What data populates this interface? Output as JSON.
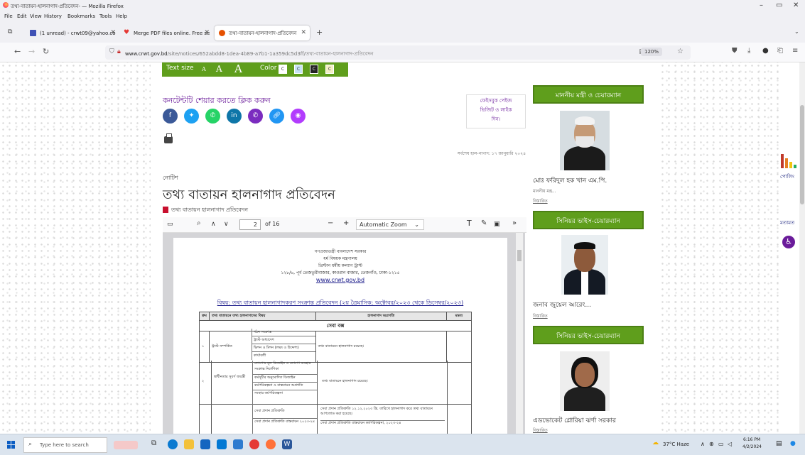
{
  "browser": {
    "window_title": "তথ্য-বাতায়ন-হালনাগাদ-প্রতিবেদন- — Mozilla Firefox",
    "menu": [
      "File",
      "Edit",
      "View",
      "History",
      "Bookmarks",
      "Tools",
      "Help"
    ],
    "tabs": [
      {
        "label": "(1 unread) - crwt09@yahoo.co",
        "icon": "mail-icon"
      },
      {
        "label": "Merge PDF files online. Free se",
        "icon": "ilovepdf-icon"
      },
      {
        "label": "তথ্য-বাতায়ন-হালনাগাদ-প্রতিবেদন",
        "icon": "site-icon"
      }
    ],
    "url_domain": "www.crwt.gov.bd",
    "url_path": "/site/notices/652abdd8-1dea-4b89-a7b1-1a359dc5d3ff/তথ্য-বাতায়ন-হালনাগাদ-প্রতিবেদন",
    "zoom": "120%"
  },
  "page": {
    "text_size_label": "Text size",
    "text_size_options": [
      "A",
      "A",
      "A"
    ],
    "color_label": "Color",
    "color_options": [
      "C",
      "C",
      "C",
      "C"
    ],
    "share_label": "কনটেন্টটি শেয়ার করতে ক্লিক করুন",
    "fb_box": [
      "ফেইসবুক পেইজ",
      "ভিজিট ও লাইক",
      "দিন।"
    ],
    "updated": "সর্বশেষ হাল-নাগাদ: ১৭ জানুয়ারি ২০২৪",
    "notice_label": "নোটিশ",
    "title": "তথ্য বাতায়ন হালনাগাদ প্রতিবেদন",
    "pdf_link": "তথ্য বাতায়ন হালনাগাদ প্রতিবেদন"
  },
  "pdf": {
    "page_current": "2",
    "page_total": "of 16",
    "zoom_option": "Automatic Zoom",
    "header_lines": [
      "গণপ্রজাতন্ত্রী বাংলাদেশ সরকার",
      "ধর্ম বিষয়ক মন্ত্রণালয়",
      "খ্রিস্টান ধর্মীয় কল্যাণ ট্রাস্ট",
      "১২৮/৬, পূর্ব তেজতুরীবাজার, কাওরান বাজার, তেজগাঁও, ঢাকা-১২১৫"
    ],
    "header_url": "www.crwt.gov.bd",
    "subject": "বিষয়: তথ্য বাতায়ন হালনাগাদকরণ সংক্রান্ত প্রতিবেদন (২য় ত্রৈমাসিক: অক্টোবর/২০২৩ থেকে ডিসেম্বর/২০২৩)",
    "table_headers": [
      "ক্রম",
      "তথ্য বাতায়নে তথ্য হালনাগাদের বিষয়",
      "হালনাগাদ অগ্রগতি",
      "মন্তব্য"
    ],
    "section_title": "সেবা বক্স",
    "groups": [
      {
        "num": "১",
        "topic": "ট্রাস্ট সম্পর্কিত",
        "items": [
          "গঠন সংক্রান্ত",
          "ট্রাস্ট অধ্যাদেশ",
          "ভিশন ও মিশন (লক্ষ্য ও উদ্দেশ্য)",
          "কার্যাবলী"
        ],
        "progress": "তথ্য বাতায়নে হালনাগাদ রয়েছে।"
      },
      {
        "num": "২",
        "topic": "স্বাধীনতার সুবর্ণ জয়ন্তী",
        "items": [
          "লোগোর মূল ডিজাইন ও লোগো ব্যবহার সংক্রান্ত নির্দেশিকা",
          "কর্মসূচীর অনুমোদিত ডিজাইন",
          "কর্মপরিকল্পনা ও বাস্তবায়ন অগ্রগতি",
          "সংস্থার কর্মপরিকল্পনা"
        ],
        "progress": "তথ্য বাতায়নে হালনাগাদ রয়েছে।"
      },
      {
        "num": "",
        "topic": "",
        "items": [
          "সেবা প্রদান প্রতিশ্রুতি",
          "সেবা প্রদান প্রতিশ্রুতি বাস্তবায়ন ২০২৩-২৪"
        ],
        "progress_lines": [
          "সেবা প্রদান প্রতিশ্রুতি ১২.১২.২০২৩ খ্রি. তারিখে হালনাগাদ করে তথ্য বাতায়নে আপলোড করা হয়েছে।",
          "সেবা প্রদান প্রতিশ্রুতি বাস্তবায়ন কর্মপরিকল্পনা, ২০২৩-২৪"
        ]
      }
    ]
  },
  "sidebar": {
    "sections": [
      {
        "heading": "মাননীয় মন্ত্রী ও চেয়ারম্যান",
        "name": "মোঃ ফরিদুল হক খান এম.পি.",
        "role": "মাননীয় মন্ত্র...",
        "more": "বিস্তারিত"
      },
      {
        "heading": "সিনিয়র ভাইস-চেয়ারম্যান",
        "name": "জনাব জুয়েল আরেং...",
        "more": "বিস্তারিত"
      },
      {
        "heading": "সিনিয়র ভাইস-চেয়ারম্যান",
        "name": "এডভোকেট গ্লোরিয়া ঝর্ণা সরকার",
        "more": "বিস্তারিত"
      }
    ]
  },
  "right_tools": {
    "poll": "পোলিং",
    "feedback": "মতামত"
  },
  "taskbar": {
    "search_placeholder": "Type here to search",
    "weather": "37°C Haze",
    "time": "6:16 PM",
    "date": "4/2/2024"
  },
  "colors": {
    "green": "#5f9e1c",
    "purple": "#6a1b9a"
  }
}
